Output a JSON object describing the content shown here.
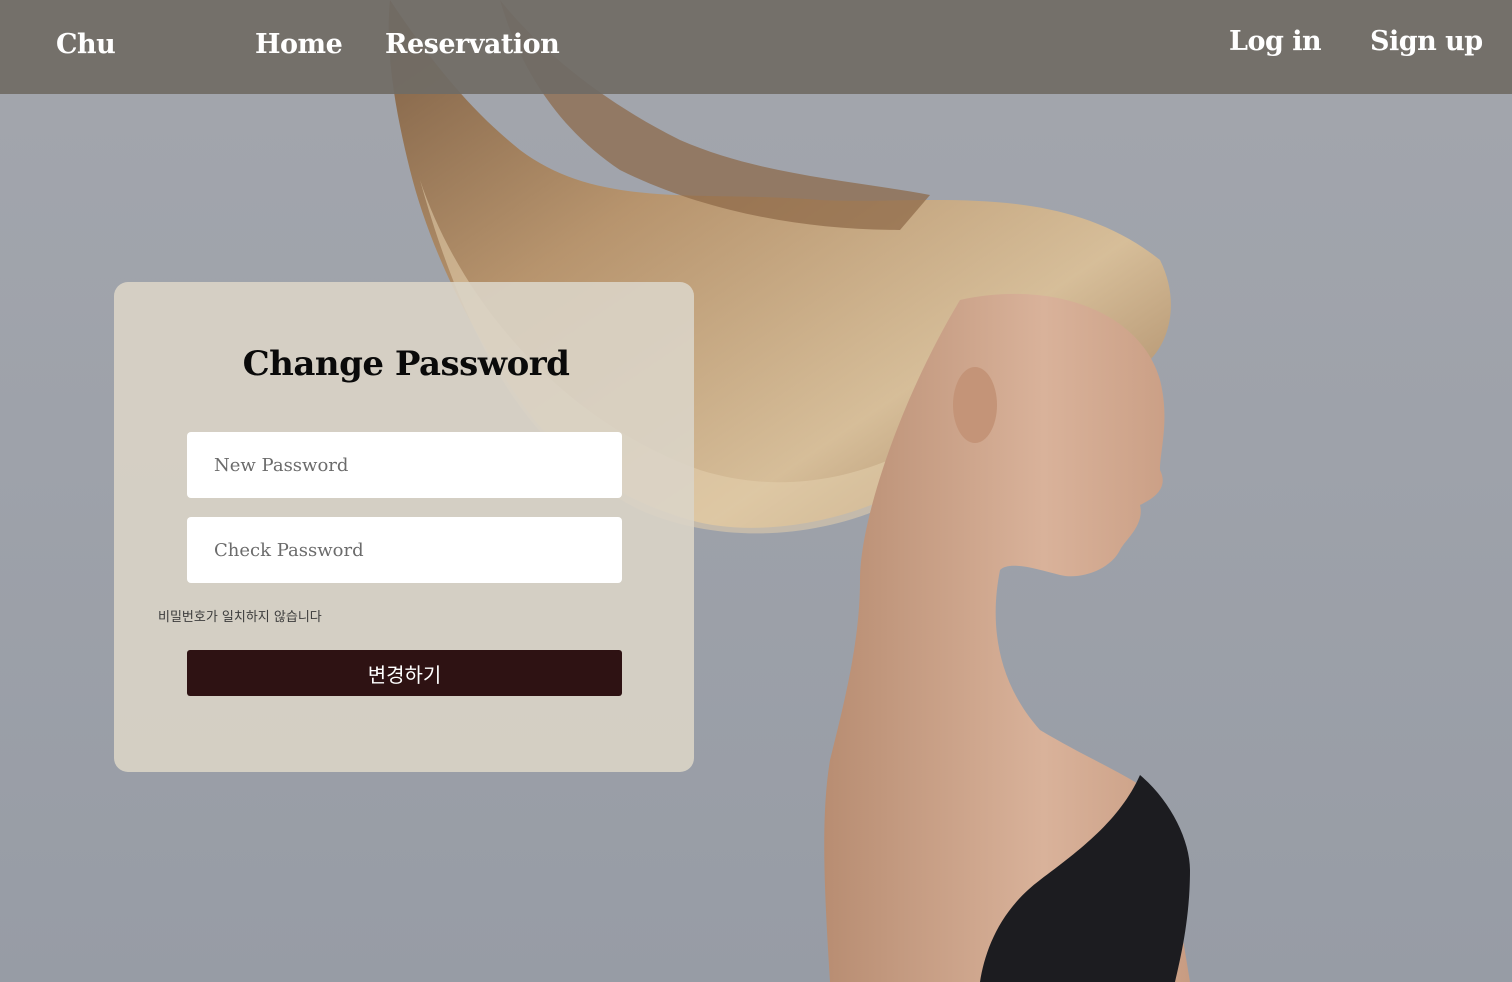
{
  "nav": {
    "brand": "Chu",
    "home": "Home",
    "reservation": "Reservation",
    "login": "Log in",
    "signup": "Sign up"
  },
  "form": {
    "title": "Change Password",
    "new_password_placeholder": "New Password",
    "check_password_placeholder": "Check Password",
    "error_message": "비밀번호가 일치하지 않습니다",
    "submit_label": "변경하기"
  }
}
